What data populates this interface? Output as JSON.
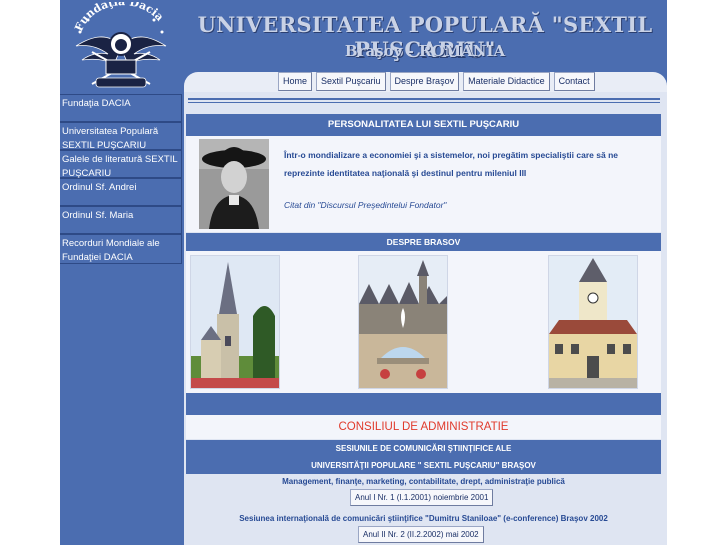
{
  "header": {
    "title": "UNIVERSITATEA POPULARĂ \"SEXTIL PUŞCARIU\"",
    "subtitle": "Braşov - ROMÂNIA",
    "logo_text": "Fundaţia Dacia"
  },
  "nav": [
    {
      "label": "Home"
    },
    {
      "label": "Sextil Puşcariu"
    },
    {
      "label": "Despre Braşov"
    },
    {
      "label": "Materiale Didactice"
    },
    {
      "label": "Contact"
    }
  ],
  "sidebar": {
    "items": [
      {
        "label": "Fundaţia DACIA"
      },
      {
        "label": "Universitatea Populară SEXTIL PUŞCARIU"
      },
      {
        "label": "Galele de literatură SEXTIL PUŞCARIU"
      },
      {
        "label": "Ordinul Sf. Andrei"
      },
      {
        "label": "Ordinul Sf. Maria"
      },
      {
        "label": "Recorduri Mondiale ale Fundaţiei DACIA"
      }
    ]
  },
  "main": {
    "personality_title": "PERSONALITATEA LUI SEXTIL PUŞCARIU",
    "quote": "Într-o mondializare a economiei şi a sistemelor, noi pregătim specialiştii care să ne reprezinte identitatea naţională şi destinul pentru mileniul III",
    "quote_cite": "Citat din \"Discursul Preşedintelui Fondator\"",
    "brasov_title": "DESPRE BRASOV",
    "council": "CONSILIUL DE ADMINISTRATIE",
    "sessions_line1": "SESIUNILE DE COMUNICĂRI ŞTIINŢIFICE ALE",
    "sessions_line2": "UNIVERSITĂŢII POPULARE \" SEXTIL PUŞCARIU\" BRAŞOV",
    "management": "Management, finanţe, marketing, contabilitate, drept, administraţie publică",
    "year1_button": "Anul I Nr. 1 (I.1.2001) noiembrie 2001",
    "conference": "Sesiunea internaţională de comunicări ştiinţifice \"Dumitru Staniloae\" (e-conference) Braşov 2002",
    "year2_button": "Anul II Nr. 2 (II.2.2002) mai 2002"
  },
  "colors": {
    "primary_blue": "#4b6db0",
    "council_red": "#e03a2c",
    "text_blue": "#274a94"
  }
}
